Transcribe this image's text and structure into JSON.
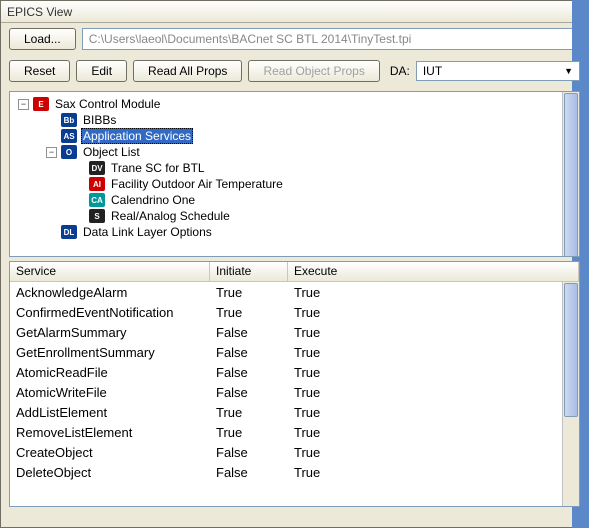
{
  "window": {
    "title": "EPICS View"
  },
  "toolbar1": {
    "load_label": "Load...",
    "path": "C:\\Users\\laeol\\Documents\\BACnet SC BTL 2014\\TinyTest.tpi"
  },
  "toolbar2": {
    "reset_label": "Reset",
    "edit_label": "Edit",
    "read_all_label": "Read All Props",
    "read_obj_label": "Read Object Props",
    "da_label": "DA:",
    "da_value": "IUT"
  },
  "tree": {
    "root": {
      "icon": "E",
      "label": "Sax Control Module"
    },
    "bibbs": {
      "icon": "Bb",
      "label": "BIBBs"
    },
    "appsvc": {
      "icon": "AS",
      "label": "Application Services"
    },
    "objlist": {
      "icon": "O",
      "label": "Object List"
    },
    "obj1": {
      "icon": "DV",
      "label": "Trane SC for BTL"
    },
    "obj2": {
      "icon": "AI",
      "label": "Facility Outdoor Air Temperature"
    },
    "obj3": {
      "icon": "CA",
      "label": "Calendrino One"
    },
    "obj4": {
      "icon": "S",
      "label": "Real/Analog Schedule"
    },
    "dll": {
      "icon": "DL",
      "label": "Data Link Layer Options"
    }
  },
  "table": {
    "headers": {
      "service": "Service",
      "initiate": "Initiate",
      "execute": "Execute"
    },
    "rows": [
      {
        "service": "AcknowledgeAlarm",
        "initiate": "True",
        "execute": "True"
      },
      {
        "service": "ConfirmedEventNotification",
        "initiate": "True",
        "execute": "True"
      },
      {
        "service": "GetAlarmSummary",
        "initiate": "False",
        "execute": "True"
      },
      {
        "service": "GetEnrollmentSummary",
        "initiate": "False",
        "execute": "True"
      },
      {
        "service": "AtomicReadFile",
        "initiate": "False",
        "execute": "True"
      },
      {
        "service": "AtomicWriteFile",
        "initiate": "False",
        "execute": "True"
      },
      {
        "service": "AddListElement",
        "initiate": "True",
        "execute": "True"
      },
      {
        "service": "RemoveListElement",
        "initiate": "True",
        "execute": "True"
      },
      {
        "service": "CreateObject",
        "initiate": "False",
        "execute": "True"
      },
      {
        "service": "DeleteObject",
        "initiate": "False",
        "execute": "True"
      }
    ]
  }
}
